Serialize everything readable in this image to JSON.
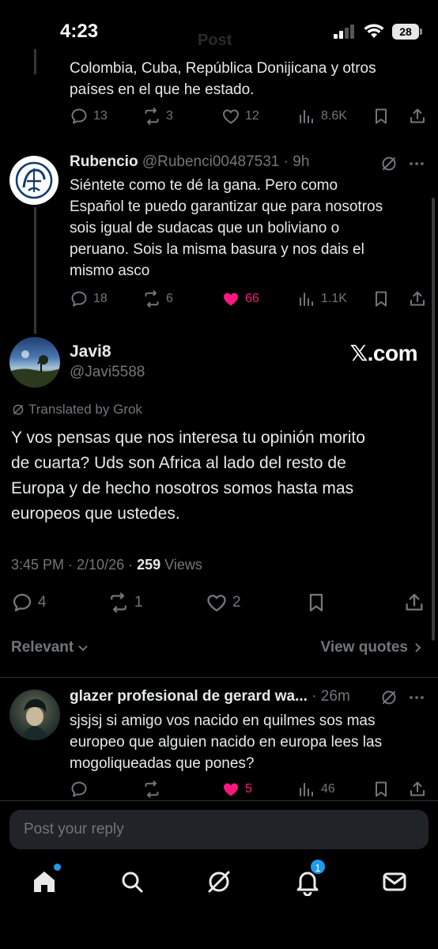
{
  "status_bar": {
    "time": "4:23",
    "ghost_title": "Post",
    "battery": "28"
  },
  "previous_tweet": {
    "text_line1": "Colombia, Cuba, República Donijicana y otros",
    "text_line2": "países en el que he estado.",
    "replies": "13",
    "reposts": "3",
    "likes": "12",
    "views": "8.6K"
  },
  "reply_rubencio": {
    "name": "Rubencio",
    "handle": "@Rubenci00487531",
    "time": "· 9h",
    "lines": [
      "Siéntete como te dé la gana. Pero como",
      "Español te puedo garantizar que para nosotros",
      "sois igual de sudacas que un boliviano o",
      "peruano. Sois la misma basura y nos dais el",
      "mismo asco"
    ],
    "replies": "18",
    "reposts": "6",
    "likes": "66",
    "views": "1.1K"
  },
  "main_tweet": {
    "name": "Javi8",
    "handle": "@Javi5588",
    "watermark": "𝕏.com",
    "translated_label": "Translated by Grok",
    "lines": [
      "Y vos pensas que nos interesa tu opinión morito",
      "de cuarta? Uds son Africa al lado del resto de",
      "Europa y de hecho nosotros somos hasta mas",
      "europeos que ustedes."
    ],
    "time": "3:45 PM · 2/10/26 · ",
    "views_count": "259",
    "views_label": " Views",
    "replies": "4",
    "reposts": "1",
    "likes": "2"
  },
  "sort": {
    "relevant_label": "Relevant",
    "view_quotes_label": "View quotes"
  },
  "reply_glazer": {
    "name": "glazer profesional de gerard wa...",
    "time": "· 26m",
    "lines": [
      "sjsjsj si amigo vos nacido en quilmes sos mas",
      "europeo que alguien nacido en europa lees las",
      "mogoliqueadas que pones?"
    ],
    "likes": "5",
    "views": "46"
  },
  "reply_box": {
    "placeholder": "Post your reply"
  },
  "tabbar": {
    "notifications_badge": "1"
  },
  "colors": {
    "background": "#000000",
    "muted": "#71767b",
    "like": "#f91880",
    "accent": "#1d9bf0"
  }
}
